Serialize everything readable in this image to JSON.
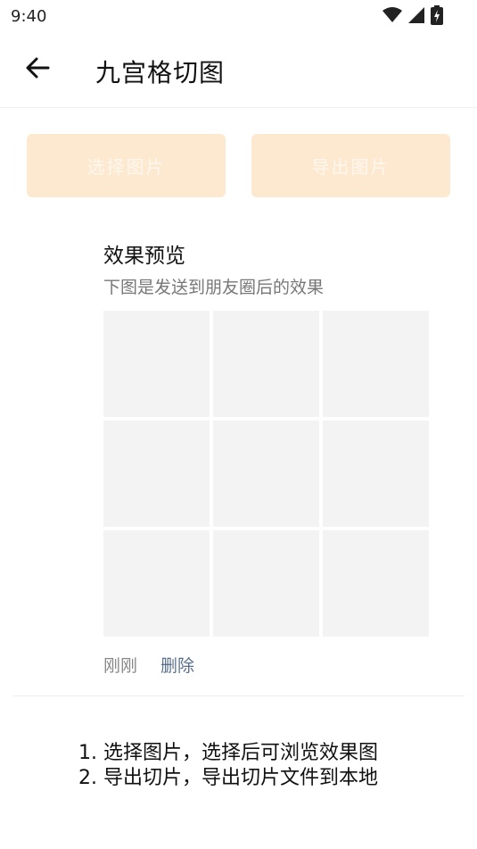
{
  "status_bar": {
    "time": "9:40",
    "icons": [
      "wifi-icon",
      "signal-icon",
      "battery-icon"
    ]
  },
  "app_bar": {
    "back_icon": "arrow-left-icon",
    "title": "九宫格切图"
  },
  "actions": {
    "select_image": "选择图片",
    "export_image": "导出图片"
  },
  "preview": {
    "title": "效果预览",
    "subtitle": "下图是发送到朋友圈后的效果",
    "cell_count": 9,
    "time": "刚刚",
    "delete": "删除"
  },
  "instructions": {
    "step1": "1. 选择图片，选择后可浏览效果图",
    "step2": "2. 导出切片，导出切片文件到本地"
  },
  "colors": {
    "button_bg": "#fde9d0",
    "cell_bg": "#f3f3f3",
    "link": "#5a6f8c"
  }
}
